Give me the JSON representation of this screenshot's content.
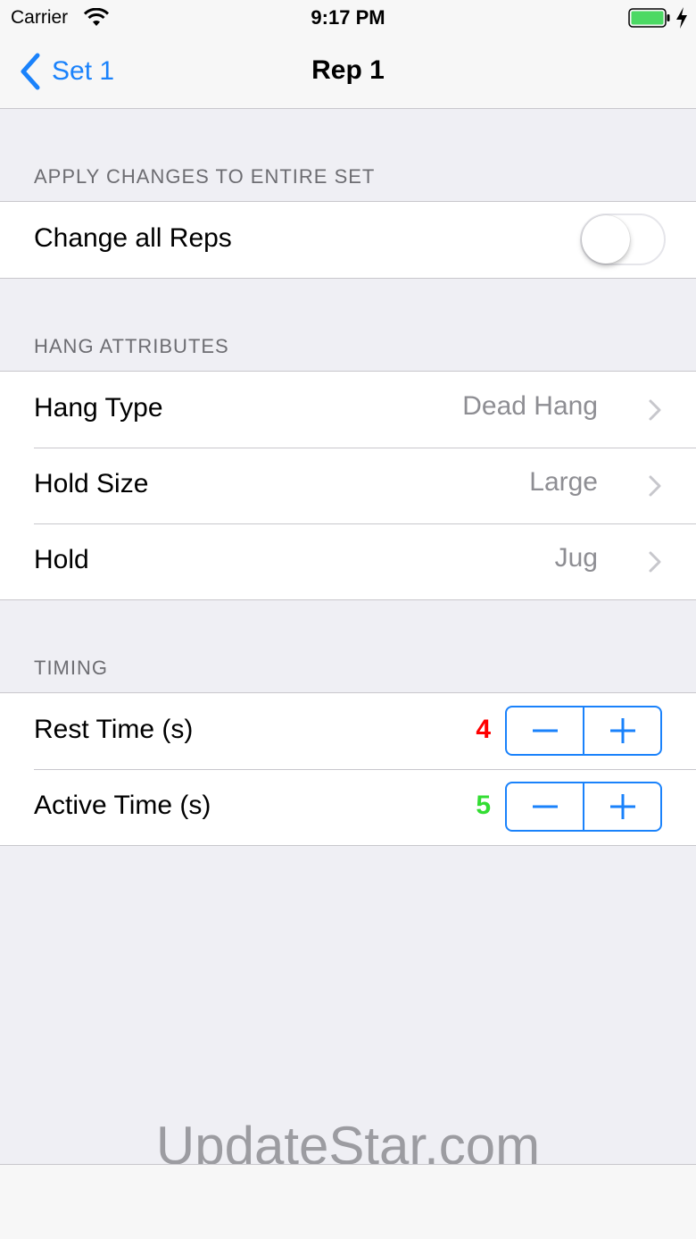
{
  "status_bar": {
    "carrier": "Carrier",
    "time": "9:17 PM",
    "icons": [
      "wifi-icon",
      "battery-icon",
      "charging-bolt-icon"
    ],
    "battery_color": "#4cd964"
  },
  "nav": {
    "back_label": "Set 1",
    "title": "Rep 1",
    "accent_color": "#1a82fb"
  },
  "sections": {
    "apply": {
      "header": "APPLY CHANGES TO ENTIRE SET",
      "change_all_label": "Change all Reps",
      "change_all_on": false
    },
    "hang": {
      "header": "HANG ATTRIBUTES",
      "rows": [
        {
          "label": "Hang Type",
          "value": "Dead Hang"
        },
        {
          "label": "Hold Size",
          "value": "Large"
        },
        {
          "label": "Hold",
          "value": "Jug"
        }
      ]
    },
    "timing": {
      "header": "TIMING",
      "rest_label": "Rest Time (s)",
      "rest_value": "4",
      "rest_color": "#ff0000",
      "active_label": "Active Time (s)",
      "active_value": "5",
      "active_color": "#33dd33"
    }
  },
  "watermark": "UpdateStar.com"
}
